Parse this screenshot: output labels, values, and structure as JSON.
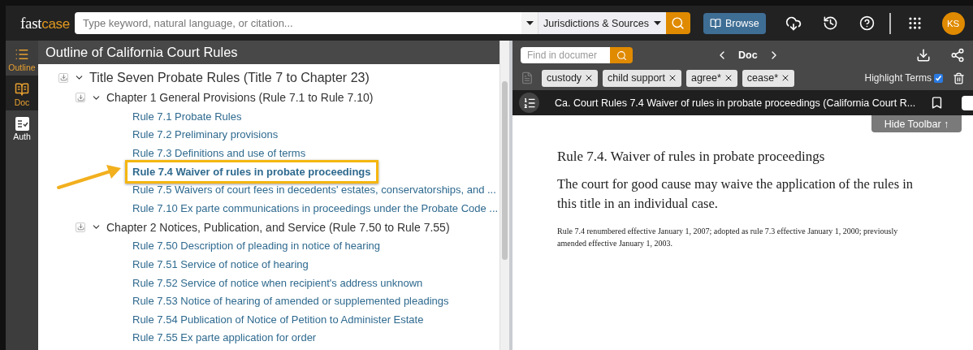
{
  "header": {
    "logo": [
      {
        "text": "fast",
        "kind": "plain"
      },
      {
        "text": "case",
        "kind": "accent"
      }
    ],
    "search": {
      "placeholder": "Type keyword, natural language, or citation..."
    },
    "jurisdictions": "Jurisdictions & Sources",
    "browse": "Browse",
    "avatar": "KS"
  },
  "rail": [
    {
      "label": "Outline",
      "on": true,
      "selected": false
    },
    {
      "label": "Doc",
      "on": true,
      "selected": true
    },
    {
      "label": "Auth",
      "on": false,
      "selected": false
    }
  ],
  "outline": {
    "title": "Outline of California Court Rules",
    "tree": [
      {
        "kind": "title",
        "label": "Title Seven Probate Rules (Title 7 to Chapter 23)",
        "expanded": true,
        "children": [
          {
            "kind": "chapter",
            "label": "Chapter 1 General Provisions (Rule 7.1 to Rule 7.10)",
            "expanded": true,
            "children": [
              {
                "kind": "rule",
                "label": "Rule 7.1 Probate Rules",
                "selected": false
              },
              {
                "kind": "rule",
                "label": "Rule 7.2 Preliminary provisions",
                "selected": false
              },
              {
                "kind": "rule",
                "label": "Rule 7.3 Definitions and use of terms",
                "selected": false
              },
              {
                "kind": "rule",
                "label": "Rule 7.4 Waiver of rules in probate proceedings",
                "selected": true
              },
              {
                "kind": "rule",
                "label": "Rule 7.5 Waivers of court fees in decedents' estates, conservatorships, and ...",
                "selected": false
              },
              {
                "kind": "rule",
                "label": "Rule 7.10 Ex parte communications in proceedings under the Probate Code ...",
                "selected": false
              }
            ]
          },
          {
            "kind": "chapter",
            "label": "Chapter 2 Notices, Publication, and Service (Rule 7.50 to Rule 7.55)",
            "expanded": true,
            "children": [
              {
                "kind": "rule",
                "label": "Rule 7.50 Description of pleading in notice of hearing",
                "selected": false
              },
              {
                "kind": "rule",
                "label": "Rule 7.51 Service of notice of hearing",
                "selected": false
              },
              {
                "kind": "rule",
                "label": "Rule 7.52 Service of notice when recipient's address unknown",
                "selected": false
              },
              {
                "kind": "rule",
                "label": "Rule 7.53 Notice of hearing of amended or supplemented pleadings",
                "selected": false
              },
              {
                "kind": "rule",
                "label": "Rule 7.54 Publication of Notice of Petition to Administer Estate",
                "selected": false
              },
              {
                "kind": "rule",
                "label": "Rule 7.55 Ex parte application for order",
                "selected": false
              }
            ]
          }
        ]
      }
    ]
  },
  "doc_toolbar": {
    "find": {
      "placeholder": "Find in documer"
    },
    "nav": "Doc",
    "terms": [
      {
        "label": "custody"
      },
      {
        "label": "child support"
      },
      {
        "label": "agree*"
      },
      {
        "label": "cease*"
      }
    ],
    "highlight_terms": {
      "label": "Highlight Terms",
      "checked": true
    }
  },
  "document": {
    "title": "Ca. Court Rules 7.4 Waiver of rules in probate proceedings (California Court R...",
    "hide_toolbar": "Hide Toolbar ↑",
    "heading": "Rule 7.4. Waiver of rules in probate proceedings",
    "body": "The court for good cause may waive the application of the rules in this title in an individual case.",
    "note": "Rule 7.4 renumbered effective January 1, 2007; adopted as rule 7.3 effective January 1, 2000; previously amended effective January 1, 2003."
  }
}
